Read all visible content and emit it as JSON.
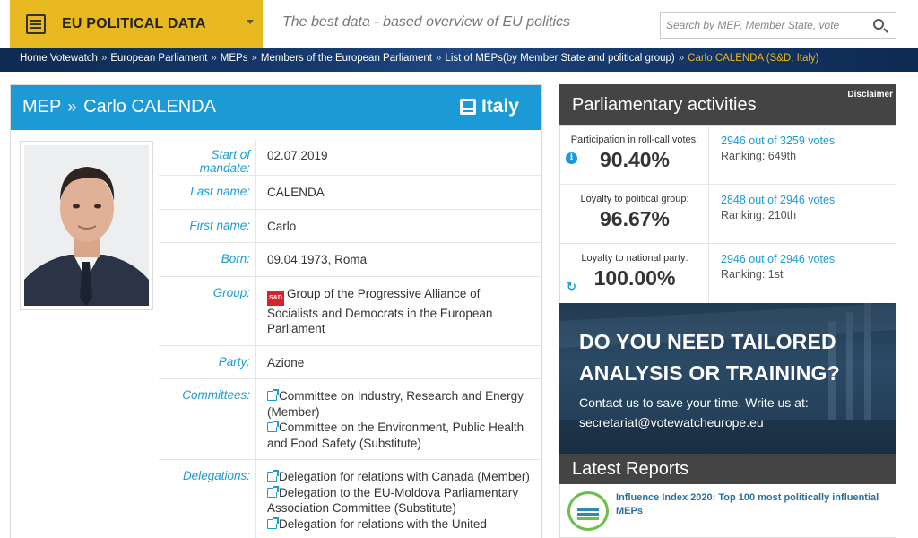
{
  "header": {
    "logo_title": "EU POLITICAL DATA",
    "tagline": "The best data - based overview of EU politics",
    "search_placeholder": "Search by MEP, Member State, vote"
  },
  "breadcrumb": [
    "Home Votewatch",
    "European Parliament",
    "MEPs",
    "Members of the European Parliament",
    "List of MEPs(by Member State and political group)",
    "Carlo CALENDA (S&D, Italy)"
  ],
  "mep": {
    "prefix": "MEP",
    "name": "Carlo CALENDA",
    "country": "Italy",
    "fields": {
      "mandate_label": "Start of mandate:",
      "mandate": "02.07.2019",
      "last_name_label": "Last name:",
      "last_name": "CALENDA",
      "first_name_label": "First name:",
      "first_name": "Carlo",
      "born_label": "Born:",
      "born": "09.04.1973, Roma",
      "group_label": "Group:",
      "group_badge": "S&D",
      "group": "Group of the Progressive Alliance of Socialists and Democrats in the European Parliament",
      "party_label": "Party:",
      "party": "Azione",
      "committees_label": "Committees:",
      "committees": [
        "Committee on Industry, Research and Energy (Member)",
        "Committee on the Environment, Public Health and Food Safety (Substitute)"
      ],
      "delegations_label": "Delegations:",
      "delegations": [
        "Delegation for relations with Canada (Member)",
        "Delegation to the EU-Moldova Parliamentary Association Committee (Substitute)",
        "Delegation for relations with the United"
      ]
    }
  },
  "activities": {
    "title": "Parliamentary activities",
    "disclaimer": "Disclaimer",
    "stats": [
      {
        "label": "Participation in roll-call votes:",
        "value": "90.40%",
        "votes": "2946 out of 3259 votes",
        "ranking": "Ranking: 649th"
      },
      {
        "label": "Loyalty to political group:",
        "value": "96.67%",
        "votes": "2848 out of 2946 votes",
        "ranking": "Ranking: 210th"
      },
      {
        "label": "Loyalty to national party:",
        "value": "100.00%",
        "votes": "2946 out of 2946 votes",
        "ranking": "Ranking: 1st"
      }
    ]
  },
  "promo": {
    "heading": "DO YOU NEED TAILORED ANALYSIS OR TRAINING?",
    "text": "Contact us to save your time. Write us at: secretariat@votewatcheurope.eu"
  },
  "reports": {
    "title": "Latest Reports",
    "items": [
      {
        "title": "Influence Index 2020: Top 100 most politically influential MEPs"
      }
    ]
  },
  "colors": {
    "accent_blue": "#1b9ad6",
    "brand_yellow": "#e8b820",
    "dark_header": "#444444",
    "sd_red": "#d7242c"
  }
}
